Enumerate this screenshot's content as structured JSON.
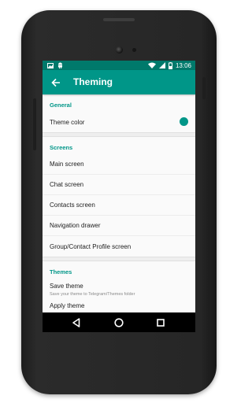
{
  "status_bar": {
    "time": "13:06",
    "left_icons": [
      "image-icon",
      "android-icon"
    ],
    "right_icons": [
      "wifi-icon",
      "signal-icon",
      "battery-icon"
    ]
  },
  "toolbar": {
    "title": "Theming",
    "back_icon": "arrow-back-icon"
  },
  "sections": {
    "general": {
      "header": "General",
      "theme_color_label": "Theme color"
    },
    "screens": {
      "header": "Screens",
      "items": [
        "Main screen",
        "Chat screen",
        "Contacts screen",
        "Navigation drawer",
        "Group/Contact Profile screen"
      ]
    },
    "themes": {
      "header": "Themes",
      "save_title": "Save theme",
      "save_subtitle": "Save your theme to Telegram/Themes folder",
      "cut_item": "Apply theme"
    }
  },
  "colors": {
    "accent": "#009688",
    "statusbar": "#00796b",
    "theme_color_swatch": "#009688"
  },
  "nav_bar": [
    "back-triangle-icon",
    "home-circle-icon",
    "recents-square-icon"
  ]
}
